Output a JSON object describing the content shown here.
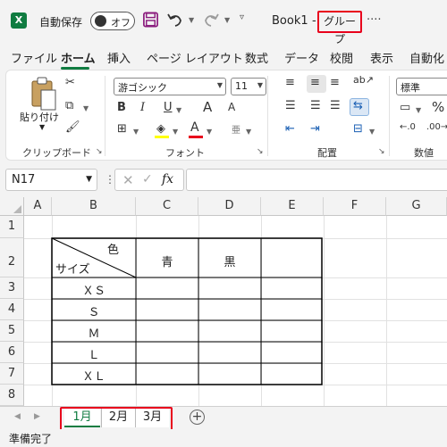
{
  "titlebar": {
    "app_icon": "excel-icon",
    "autosave_label": "自動保存",
    "autosave_state": "オフ",
    "doc_name": "Book1",
    "doc_separator": "-",
    "group_label": "グループ",
    "more": "····"
  },
  "tabs": [
    "ファイル",
    "ホーム",
    "挿入",
    "ページ レイアウト",
    "数式",
    "データ",
    "校閲",
    "表示",
    "自動化"
  ],
  "active_tab": "ホーム",
  "ribbon": {
    "clipboard": {
      "paste_label": "貼り付け",
      "group_label": "クリップボード"
    },
    "font": {
      "font_name": "游ゴシック",
      "font_size": "11",
      "bold": "B",
      "italic": "I",
      "underline": "U",
      "group_label": "フォント",
      "grow": "A",
      "shrink": "A",
      "phonetic": "亜"
    },
    "alignment": {
      "group_label": "配置"
    },
    "number": {
      "format": "標準",
      "group_label": "数値",
      "percent": "%"
    }
  },
  "formula_bar": {
    "name_box": "N17",
    "more": "⋮",
    "fx": "fx",
    "formula": ""
  },
  "columns": [
    "A",
    "B",
    "C",
    "D",
    "E",
    "F",
    "G"
  ],
  "rows": [
    "1",
    "2",
    "3",
    "4",
    "5",
    "6",
    "7",
    "8"
  ],
  "table": {
    "header_top_right": "色",
    "header_bottom_left": "サイズ",
    "col_headers": [
      "青",
      "黒",
      ""
    ],
    "row_labels": [
      "ＸＳ",
      "Ｓ",
      "Ｍ",
      "Ｌ",
      "ＸＬ"
    ]
  },
  "sheets": [
    "1月",
    "2月",
    "3月"
  ],
  "active_sheet": "1月",
  "add_sheet": "+",
  "status": "準備完了",
  "colors": {
    "accent": "#107c41",
    "highlight": "#e8001c"
  }
}
